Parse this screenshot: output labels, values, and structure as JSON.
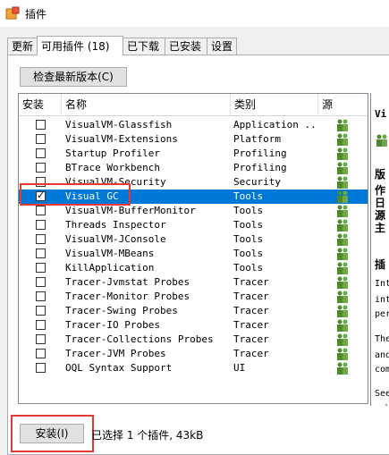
{
  "window": {
    "title": "插件",
    "icon": "plugin-app-icon"
  },
  "tabs": [
    {
      "label": "更新"
    },
    {
      "label": "可用插件 (18)"
    },
    {
      "label": "已下载"
    },
    {
      "label": "已安装"
    },
    {
      "label": "设置"
    }
  ],
  "check_button": "检查最新版本(C)",
  "columns": {
    "install": "安装",
    "name": "名称",
    "category": "类别",
    "source": "源"
  },
  "rows": [
    {
      "name": "VisualVM-Glassfish",
      "category": "Application ...",
      "checked": false
    },
    {
      "name": "VisualVM-Extensions",
      "category": "Platform",
      "checked": false
    },
    {
      "name": "Startup Profiler",
      "category": "Profiling",
      "checked": false
    },
    {
      "name": "BTrace Workbench",
      "category": "Profiling",
      "checked": false
    },
    {
      "name": "VisualVM-Security",
      "category": "Security",
      "checked": false
    },
    {
      "name": "Visual GC",
      "category": "Tools",
      "checked": true,
      "selected": true
    },
    {
      "name": "VisualVM-BufferMonitor",
      "category": "Tools",
      "checked": false
    },
    {
      "name": "Threads Inspector",
      "category": "Tools",
      "checked": false
    },
    {
      "name": "VisualVM-JConsole",
      "category": "Tools",
      "checked": false
    },
    {
      "name": "VisualVM-MBeans",
      "category": "Tools",
      "checked": false
    },
    {
      "name": "KillApplication",
      "category": "Tools",
      "checked": false
    },
    {
      "name": "Tracer-Jvmstat Probes",
      "category": "Tracer",
      "checked": false
    },
    {
      "name": "Tracer-Monitor Probes",
      "category": "Tracer",
      "checked": false
    },
    {
      "name": "Tracer-Swing Probes",
      "category": "Tracer",
      "checked": false
    },
    {
      "name": "Tracer-IO Probes",
      "category": "Tracer",
      "checked": false
    },
    {
      "name": "Tracer-Collections Probes",
      "category": "Tracer",
      "checked": false
    },
    {
      "name": "Tracer-JVM Probes",
      "category": "Tracer",
      "checked": false
    },
    {
      "name": "OQL Syntax Support",
      "category": "UI",
      "checked": false
    }
  ],
  "source_icon": "community-users-icon",
  "details": {
    "title": "Vi",
    "lines": [
      "版",
      "作",
      "日",
      "源",
      "主",
      "插",
      "Int",
      "int",
      "per",
      "The",
      "and",
      "com",
      "See",
      "- V"
    ]
  },
  "install_button": "安装(I)",
  "status": "已选择 1 个插件, 43kB",
  "colors": {
    "selection": "#0078d7",
    "highlight": "#e53935",
    "source_icon": "#4c8a2c"
  }
}
